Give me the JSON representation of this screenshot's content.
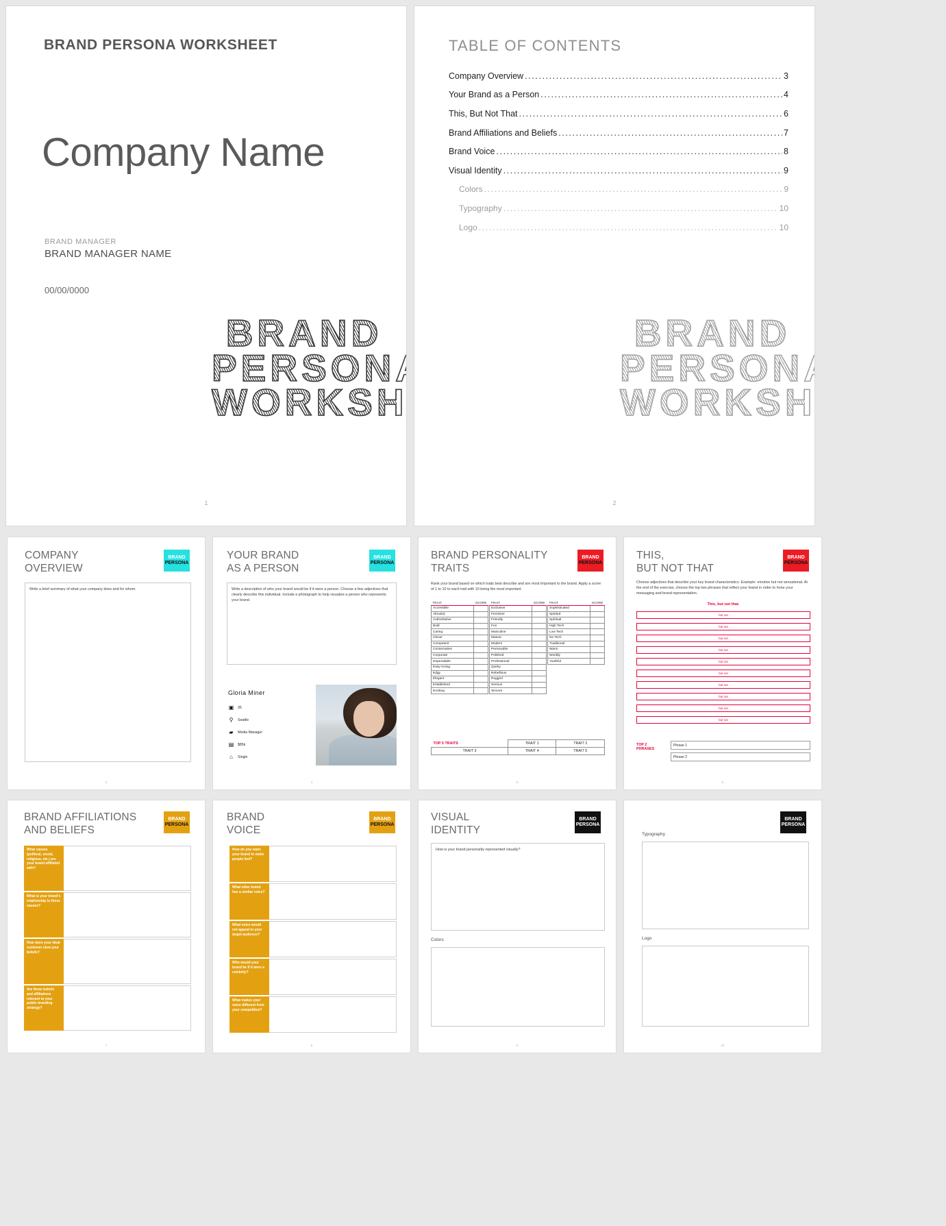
{
  "cover": {
    "kicker": "BRAND PERSONA WORKSHEET",
    "company": "Company Name",
    "bm_label": "BRAND MANAGER",
    "bm_name": "BRAND MANAGER NAME",
    "date": "00/00/0000",
    "wordmark_l1": "BRAND",
    "wordmark_l2": "PERSONA",
    "wordmark_l3": "WORKSHEET",
    "page": "1"
  },
  "toc": {
    "title": "TABLE OF CONTENTS",
    "page": "2",
    "entries": [
      {
        "label": "Company Overview",
        "page": "3",
        "sub": false
      },
      {
        "label": "Your Brand as a Person",
        "page": "4",
        "sub": false
      },
      {
        "label": "This, But Not That",
        "page": "6",
        "sub": false
      },
      {
        "label": "Brand Affiliations and Beliefs",
        "page": "7",
        "sub": false
      },
      {
        "label": "Brand Voice",
        "page": "8",
        "sub": false
      },
      {
        "label": "Visual  Identity",
        "page": "9",
        "sub": false
      },
      {
        "label": "Colors",
        "page": "9",
        "sub": true
      },
      {
        "label": "Typography",
        "page": "10",
        "sub": true
      },
      {
        "label": "Logo",
        "page": "10",
        "sub": true
      }
    ]
  },
  "badge": {
    "line1": "BRAND",
    "line2": "PERSONA"
  },
  "colors": {
    "teal": "#27E0E0",
    "red": "#EC1C24",
    "orange": "#E3A112",
    "black": "#111111",
    "accent_rule": "#E4003A"
  },
  "thumbs": {
    "company_overview": {
      "title_l1": "COMPANY",
      "title_l2": "OVERVIEW",
      "prompt": "Write a brief summary of what your company does and for whom.",
      "page": "3"
    },
    "brand_as_person": {
      "title_l1": "YOUR BRAND",
      "title_l2": "AS A PERSON",
      "prompt": "Write a description of who your brand would be if it were a person. Choose a few adjectives that clearly describe this individual. Include a photograph to help visualize a person who represents your brand.",
      "persona": {
        "name": "Gloria  Miner",
        "age": "35",
        "location": "Seattle",
        "job": "Media Manager",
        "salary": "$85k",
        "status": "Single"
      },
      "page": "4"
    },
    "personality_traits": {
      "title_l1": "BRAND PERSONALITY",
      "title_l2": "TRAITS",
      "prompt": "Rank your brand based on which traits best describe and are most important to the brand.  Apply a score of 1 to 10 to each trait with 10 being the most important.",
      "col_header_trait": "TRAIT",
      "col_header_score": "SCORE",
      "column1": [
        "Accessible",
        "Altruistic",
        "Authoritative",
        "Bold",
        "Caring",
        "Clever",
        "Competent",
        "Conservative",
        "Corporate",
        "Dependable",
        "Easy-Going",
        "Edgy",
        "Elegant",
        "Established",
        "Exciting"
      ],
      "column2": [
        "Exclusive",
        "Feminine",
        "Friendly",
        "Fun",
        "Masculine",
        "Mature",
        "Modern",
        "Personable",
        "Polished",
        "Professional",
        "Quirky",
        "Rebellious",
        "Rugged",
        "Serious",
        "Sincere"
      ],
      "column3": [
        "Sophisticated",
        "Spirited",
        "Spiritual",
        "High Tech",
        "Low Tech",
        "No Tech",
        "Traditional",
        "Warm",
        "Worldly",
        "Youthful"
      ],
      "top5_label": "TOP 5 TRAITS",
      "top5": [
        "TRAIT 1",
        "TRAIT 2",
        "TRAIT 3",
        "TRAIT 4",
        "TRAIT 5"
      ],
      "page": "5"
    },
    "this_but_not_that": {
      "title_l1": "THIS,",
      "title_l2": "BUT NOT THAT",
      "prompt": "Choose adjectives that describe your key brand characteristics. Example: emotive but not sensational. At the end of the exercise, choose the top two phrases that reflect your brand in order to hone your messaging and brand representation.",
      "table_header": "This, but not that.",
      "row_text": "but not",
      "row_count": 10,
      "top2_label_l1": "TOP 2",
      "top2_label_l2": "PHRASES",
      "phrases": [
        "Phrase 1",
        "Phrase 2"
      ],
      "page": "6"
    },
    "affiliations": {
      "title_l1": "BRAND AFFILIATIONS",
      "title_l2": "AND BELIEFS",
      "questions": [
        "What causes (political, social, religious, etc.) are your brand affiliated with?",
        "What is your brand's relationship to these causes?",
        "How does your ideal customer view your beliefs?",
        "Are these beliefs and affiliations relevant to your public branding strategy?"
      ],
      "page": "7"
    },
    "brand_voice": {
      "title_l1": "BRAND",
      "title_l2": "VOICE",
      "questions": [
        "How do you want your brand to make people feel?",
        "What other brand has a similar voice?",
        "What voice would not appeal to your target audience?",
        "Who would your brand be if it were a celebrity?",
        "What makes your voice different from your competition?"
      ],
      "page": "8"
    },
    "visual_identity": {
      "title_l1": "VISUAL",
      "title_l2": "IDENTITY",
      "prompt": "How is your brand personality represented visually?",
      "colors_label": "Colors",
      "page": "9"
    },
    "typography_logo": {
      "typography_label": "Typography",
      "logo_label": "Logo",
      "page": "10"
    }
  }
}
